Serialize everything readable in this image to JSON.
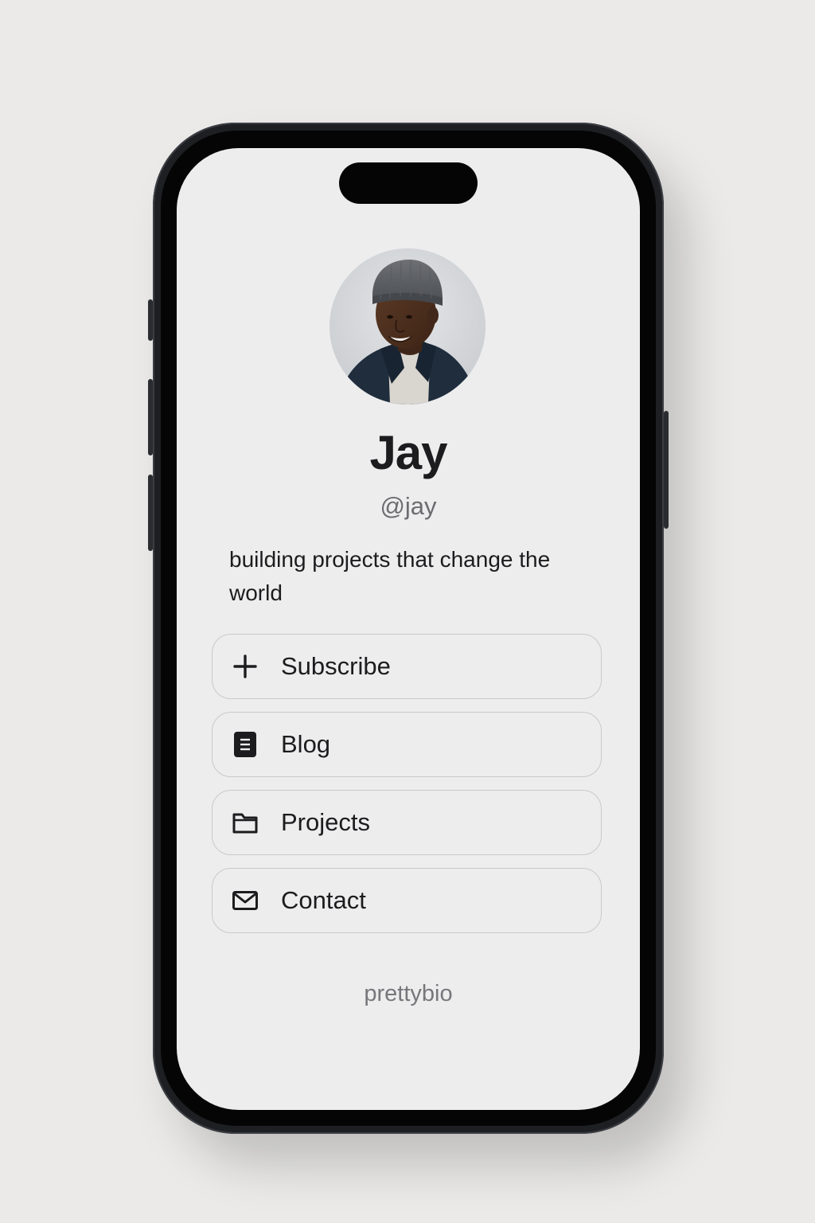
{
  "profile": {
    "name": "Jay",
    "handle": "@jay",
    "bio": "building projects that change the world",
    "avatar_icon": "profile-photo"
  },
  "links": [
    {
      "label": "Subscribe",
      "icon": "plus-icon"
    },
    {
      "label": "Blog",
      "icon": "document-icon"
    },
    {
      "label": "Projects",
      "icon": "folder-icon"
    },
    {
      "label": "Contact",
      "icon": "mail-icon"
    }
  ],
  "footer": {
    "brand": "prettybio"
  },
  "colors": {
    "page_background": "#ebeae9",
    "screen_background": "#ededee",
    "text_primary": "#1c1c1e",
    "text_secondary": "#6c6c70",
    "button_border": "#c9c9cc",
    "device_frame": "#1d1f22"
  }
}
